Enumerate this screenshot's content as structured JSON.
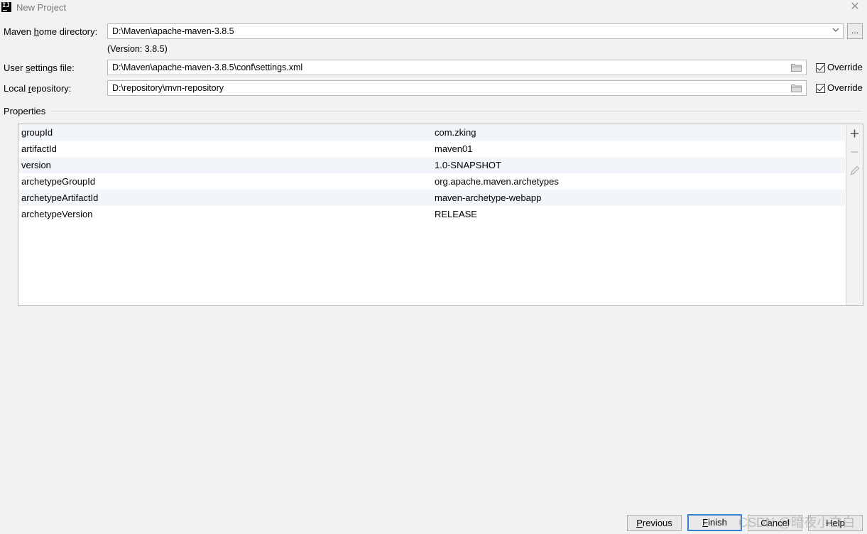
{
  "window": {
    "title": "New Project",
    "app_icon_text": "IJ"
  },
  "maven_home": {
    "label_pre": "Maven ",
    "label_mnemonic": "h",
    "label_post": "ome directory:",
    "value": "D:\\Maven\\apache-maven-3.8.5",
    "browse_label": "...",
    "version_note": "(Version: 3.8.5)"
  },
  "user_settings": {
    "label_pre": "User ",
    "label_mnemonic": "s",
    "label_post": "ettings file:",
    "value": "D:\\Maven\\apache-maven-3.8.5\\conf\\settings.xml",
    "override_label": "Override",
    "override_checked": true
  },
  "local_repo": {
    "label_pre": "Local ",
    "label_mnemonic": "r",
    "label_post": "epository:",
    "value": "D:\\repository\\mvn-repository",
    "override_label": "Override",
    "override_checked": true
  },
  "properties": {
    "section_title": "Properties",
    "rows": [
      {
        "key": "groupId",
        "value": "com.zking"
      },
      {
        "key": "artifactId",
        "value": "maven01"
      },
      {
        "key": "version",
        "value": "1.0-SNAPSHOT"
      },
      {
        "key": "archetypeGroupId",
        "value": "org.apache.maven.archetypes"
      },
      {
        "key": "archetypeArtifactId",
        "value": "maven-archetype-webapp"
      },
      {
        "key": "archetypeVersion",
        "value": "RELEASE"
      }
    ],
    "toolbar": {
      "add_icon": "plus-icon",
      "remove_icon": "minus-icon",
      "edit_icon": "pencil-icon"
    }
  },
  "footer": {
    "previous_mnemonic": "P",
    "previous_rest": "revious",
    "finish_mnemonic": "F",
    "finish_rest": "inish",
    "cancel_label": "Cancel",
    "help_label": "Help"
  },
  "watermark": "CSDN @暗夜小白白",
  "colors": {
    "accent": "#3c7fd0",
    "window_bg": "#f2f2f2",
    "row_alt": "#f2f5f9"
  }
}
